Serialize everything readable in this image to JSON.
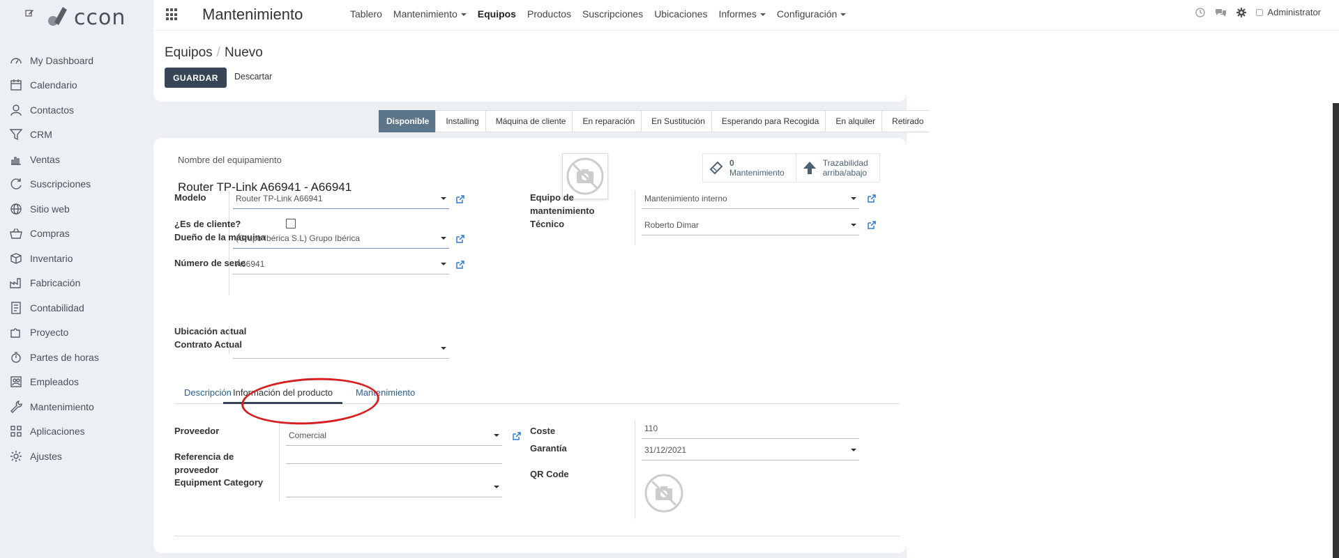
{
  "brand": {
    "logo_text": "ccon"
  },
  "sidebar": {
    "items": [
      {
        "label": "My Dashboard",
        "icon": "dashboard-icon"
      },
      {
        "label": "Calendario",
        "icon": "calendar-icon"
      },
      {
        "label": "Contactos",
        "icon": "user-icon"
      },
      {
        "label": "CRM",
        "icon": "filter-icon"
      },
      {
        "label": "Ventas",
        "icon": "chart-icon"
      },
      {
        "label": "Suscripciones",
        "icon": "refresh-icon"
      },
      {
        "label": "Sitio web",
        "icon": "globe-icon"
      },
      {
        "label": "Compras",
        "icon": "basket-icon"
      },
      {
        "label": "Inventario",
        "icon": "box-icon"
      },
      {
        "label": "Fabricación",
        "icon": "factory-icon"
      },
      {
        "label": "Contabilidad",
        "icon": "ledger-icon"
      },
      {
        "label": "Proyecto",
        "icon": "puzzle-icon"
      },
      {
        "label": "Partes de horas",
        "icon": "stopwatch-icon"
      },
      {
        "label": "Empleados",
        "icon": "people-icon"
      },
      {
        "label": "Mantenimiento",
        "icon": "wrench-icon"
      },
      {
        "label": "Aplicaciones",
        "icon": "grid-icon"
      },
      {
        "label": "Ajustes",
        "icon": "gear-icon"
      }
    ]
  },
  "topbar": {
    "app_title": "Mantenimiento",
    "menu": [
      {
        "label": "Tablero",
        "dropdown": false,
        "active": false
      },
      {
        "label": "Mantenimiento",
        "dropdown": true,
        "active": false
      },
      {
        "label": "Equipos",
        "dropdown": false,
        "active": true
      },
      {
        "label": "Productos",
        "dropdown": false,
        "active": false
      },
      {
        "label": "Suscripciones",
        "dropdown": false,
        "active": false
      },
      {
        "label": "Ubicaciones",
        "dropdown": false,
        "active": false
      },
      {
        "label": "Informes",
        "dropdown": true,
        "active": false
      },
      {
        "label": "Configuración",
        "dropdown": true,
        "active": false
      }
    ],
    "user": "Administrator"
  },
  "control": {
    "breadcrumb_parent": "Equipos",
    "breadcrumb_current": "Nuevo",
    "save_label": "GUARDAR",
    "discard_label": "Descartar"
  },
  "status": [
    "Disponible",
    "Installing",
    "Máquina de cliente",
    "En reparación",
    "En Sustitución",
    "Esperando para Recogida",
    "En alquiler",
    "Retirado"
  ],
  "form": {
    "name_label": "Nombre del equipamiento",
    "name_value": "Router TP-Link A66941 - A66941",
    "smart_maint_count": "0",
    "smart_maint_label": "Mantenimiento",
    "smart_trace_label1": "Trazabilidad",
    "smart_trace_label2": "arriba/abajo",
    "modelo_label": "Modelo",
    "modelo_value": "Router TP-Link A66941",
    "es_cliente_label": "¿Es de cliente?",
    "dueno_label": "Dueño de la máquina",
    "dueno_value": "(Grupo Ibérica  S.L) Grupo Ibérica",
    "serie_label": "Número de serie",
    "serie_value": "A66941",
    "ubicacion_label": "Ubicación actual",
    "contrato_label": "Contrato Actual",
    "equipo_mant_label1": "Equipo de",
    "equipo_mant_label2": "mantenimiento",
    "equipo_mant_value": "Mantenimiento interno",
    "tecnico_label": "Técnico",
    "tecnico_value": "Roberto Dimar"
  },
  "tabs": [
    "Descripción",
    "Información del producto",
    "Mantenimiento"
  ],
  "product_info": {
    "proveedor_label": "Proveedor",
    "proveedor_value": "Comercial",
    "ref_label1": "Referencia de",
    "ref_label2": "proveedor",
    "category_label": "Equipment Category",
    "coste_label": "Coste",
    "coste_value": "110",
    "garantia_label": "Garantía",
    "garantia_value": "31/12/2021",
    "qr_label": "QR Code"
  },
  "colors": {
    "primary": "#374656",
    "status_active": "#5c7589",
    "link": "#2b5e8f",
    "annotation": "#d61f1f"
  }
}
